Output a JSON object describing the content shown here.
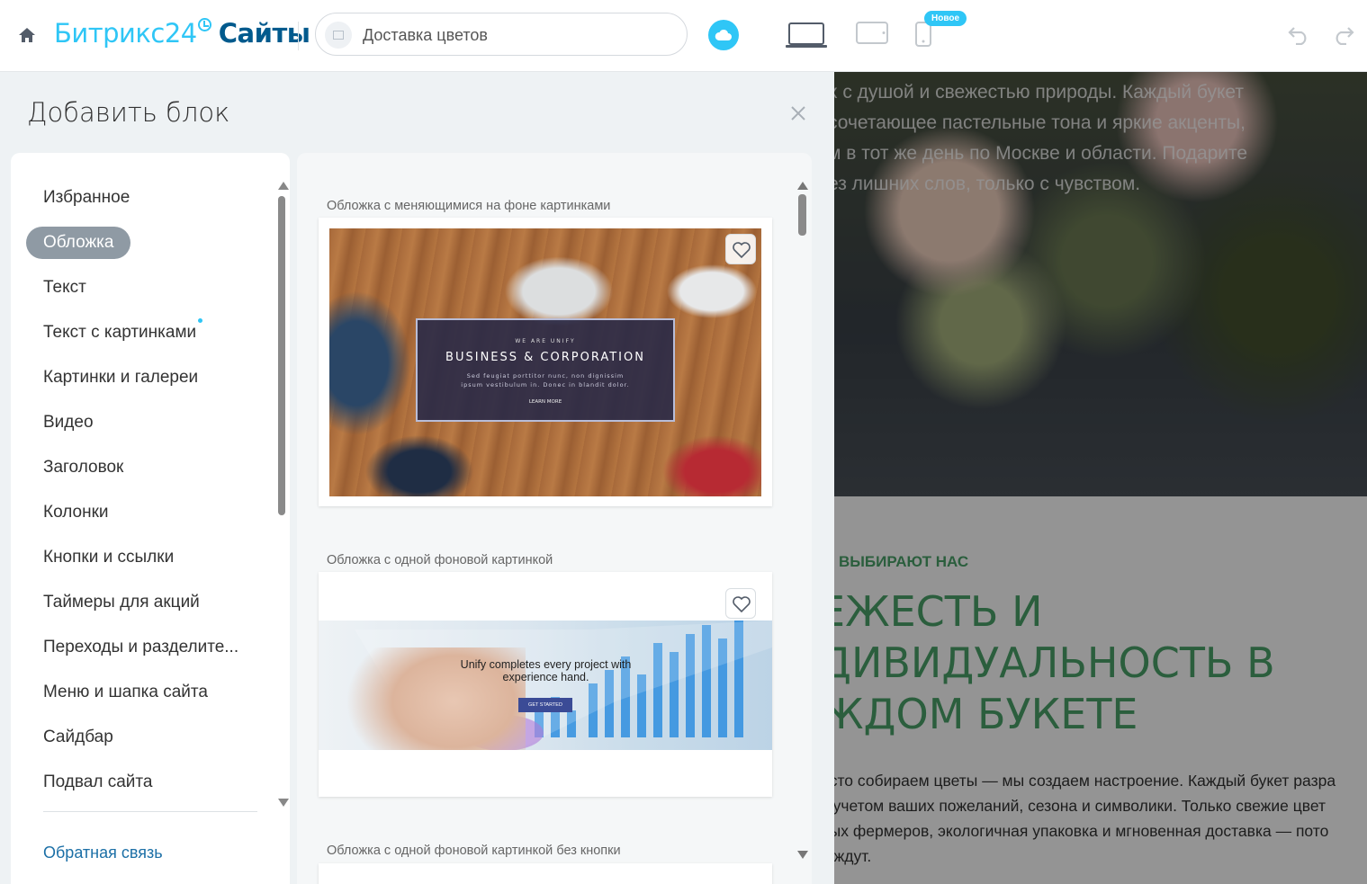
{
  "topbar": {
    "logo_brand": "Битрикс24",
    "logo_product": "Сайты",
    "site_name": "Доставка цветов",
    "badge_new": "Новое"
  },
  "panel": {
    "title": "Добавить блок",
    "categories": [
      {
        "label": "Избранное"
      },
      {
        "label": "Обложка"
      },
      {
        "label": "Текст"
      },
      {
        "label": "Текст с картинками"
      },
      {
        "label": "Картинки и галереи"
      },
      {
        "label": "Видео"
      },
      {
        "label": "Заголовок"
      },
      {
        "label": "Колонки"
      },
      {
        "label": "Кнопки и ссылки"
      },
      {
        "label": "Таймеры для акций"
      },
      {
        "label": "Переходы и разделите..."
      },
      {
        "label": "Меню и шапка сайта"
      },
      {
        "label": "Сайдбар"
      },
      {
        "label": "Подвал сайта"
      }
    ],
    "active_category": "Обложка",
    "feedback_label": "Обратная связь",
    "blocks": [
      {
        "label": "Обложка с меняющимися на фоне картинками",
        "preview_small": "WE ARE UNIFY",
        "preview_title": "BUSINESS & CORPORATION",
        "preview_desc": "Sed feugiat porttitor nunc, non dignissim\nipsum vestibulum in. Donec in blandit dolor.",
        "preview_link": "LEARN MORE"
      },
      {
        "label": "Обложка с одной фоновой картинкой",
        "preview_text": "Unify completes every project with\nexperience hand.",
        "preview_button": "GET STARTED"
      },
      {
        "label": "Обложка с одной фоновой картинкой без кнопки"
      }
    ]
  },
  "preview_page": {
    "hero_text": "х с душой и свежестью природы. Каждый букет\nсочетающее пастельные тона и яркие акценты,\nм в тот же день по Москве и области. Подарите\nез лишних слов, только с чувством.",
    "section_eyebrow": "ВЫБИРАЮТ НАС",
    "section_title": "ЕЖЕСТЬ И\nДИВИДУАЛЬНОСТЬ В\nЖДОМ БУКЕТЕ",
    "section_text": "осто собираем цветы — мы создаем настроение. Каждый букет разра\nс учетом ваших пожеланий, сезона и символики. Только свежие цвет\nных фермеров, экологичная упаковка и мгновенная доставка — пото\nе ждут."
  },
  "colors": {
    "accent": "#2fc6f6",
    "brand_dark": "#005a8d",
    "active_category_bg": "#8f9aa4",
    "section_green": "#4aa36a",
    "link": "#1b6fa6"
  },
  "icons": [
    "home-icon",
    "cloud-icon",
    "desktop-icon",
    "tablet-icon",
    "mobile-icon",
    "undo-icon",
    "redo-icon",
    "close-icon",
    "heart-icon"
  ]
}
